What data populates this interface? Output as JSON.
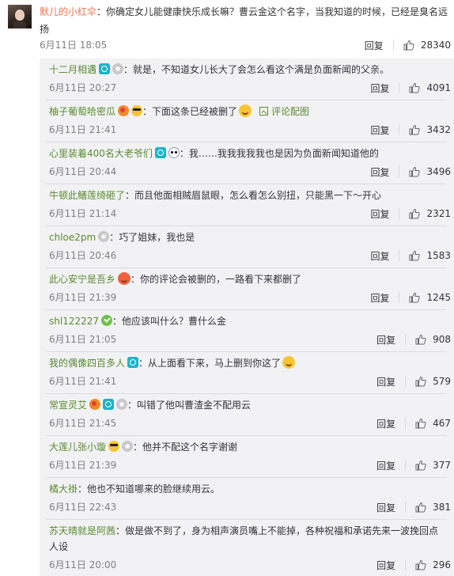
{
  "main": {
    "username": "默儿的小红伞",
    "text_line1": "：你确定女儿能健康快乐成长嘛？曹云金这个名字，当我知道的时候，已经是臭名远",
    "text_line2": "扬",
    "time": "6月11日 18:05",
    "reply_label": "回复",
    "likes": "28340"
  },
  "replies": [
    {
      "username": "十二月相遇",
      "badges": [
        "vip",
        "medal"
      ],
      "text": "：就是，不知道女儿长大了会怎么看这个满是负面新闻的父亲。",
      "time": "6月11日 20:27",
      "reply_label": "回复",
      "likes": "4091"
    },
    {
      "username": "柚子葡萄哈密瓜",
      "badges": [
        "heart",
        "cool"
      ],
      "text": "：下面这条已经被删了",
      "link": "评论配图",
      "time": "6月11日 21:41",
      "reply_label": "回复",
      "likes": "3432"
    },
    {
      "username": "心里装着400名大老爷们",
      "badges": [
        "vip",
        "panda"
      ],
      "text": "：我……我我我我我也是因为负面新闻知道他的",
      "time": "6月11日 20:44",
      "reply_label": "回复",
      "likes": "3496"
    },
    {
      "username": "牛顿此鳝莲绮砸了",
      "badges": [],
      "text": "：而且他面相贼眉鼠眼，怎么看怎么别扭，只能黑一下～开心",
      "time": "6月11日 21:14",
      "reply_label": "回复",
      "likes": "2321"
    },
    {
      "username": "chloe2pm",
      "badges": [
        "medal"
      ],
      "text": "：巧了姐妹，我也是",
      "time": "6月11日 20:46",
      "reply_label": "回复",
      "likes": "1583"
    },
    {
      "username": "此心安宁是吾乡",
      "badges": [
        "emoji-red"
      ],
      "text": "：你的评论会被删的，一路看下来都删了",
      "time": "6月11日 21:39",
      "reply_label": "回复",
      "likes": "1245"
    },
    {
      "username": "shl122227",
      "badges": [
        "green"
      ],
      "text": "：他应该叫什么？曹什么金",
      "time": "6月11日 21:05",
      "reply_label": "回复",
      "likes": "908"
    },
    {
      "username": "我的偶像四百多人",
      "badges": [
        "vip"
      ],
      "text": "：从上面看下来，马上删到你这了",
      "time": "6月11日 21:41",
      "reply_label": "回复",
      "likes": "579"
    },
    {
      "username": "常宣灵艾",
      "badges": [
        "heart",
        "vip",
        "medal"
      ],
      "text": "：叫错了他叫曹渣金不配用云",
      "time": "6月11日 21:45",
      "reply_label": "回复",
      "likes": "467"
    },
    {
      "username": "大莲儿张小璇",
      "badges": [
        "cool",
        "medal"
      ],
      "text": "：他并不配这个名字谢谢",
      "time": "6月11日 21:39",
      "reply_label": "回复",
      "likes": "377"
    },
    {
      "username": "橘大褂",
      "badges": [],
      "text": "：他也不知道哪来的脸继续用云。",
      "time": "6月11日 22:43",
      "reply_label": "回复",
      "likes": "381"
    },
    {
      "username": "苏天晴就是阿茜",
      "badges": [],
      "text": "：做是做不到了，身为相声演员嘴上不能掉，各种祝福和承诺先来一波挽回点",
      "text_line2": "人设",
      "time": "6月11日 20:00",
      "reply_label": "回复",
      "likes": "296"
    }
  ]
}
